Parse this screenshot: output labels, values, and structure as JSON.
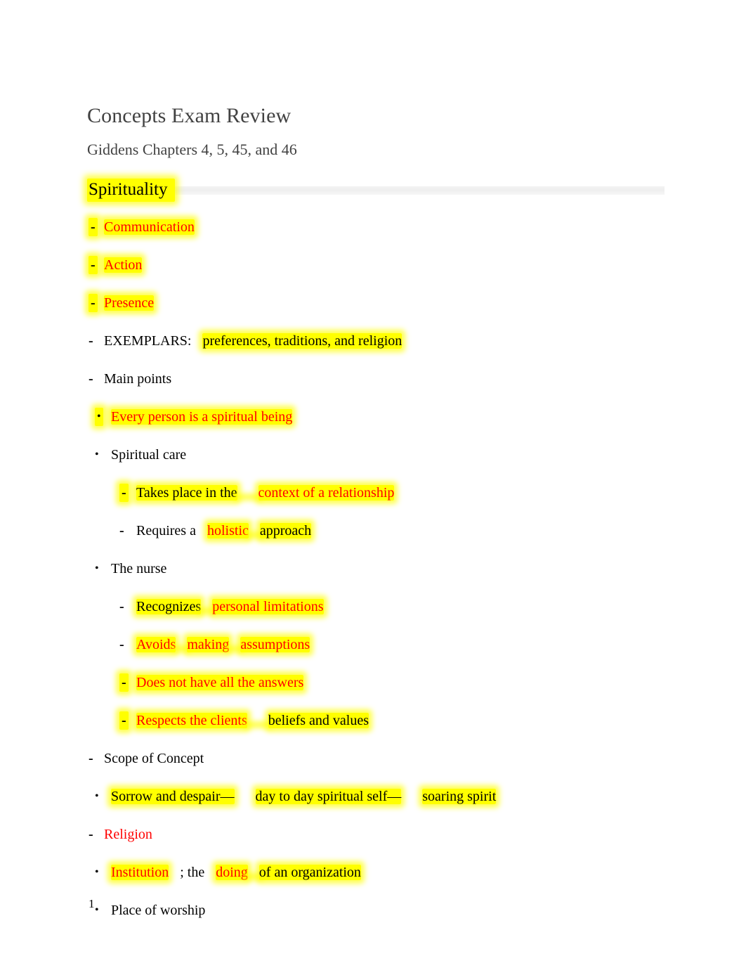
{
  "document": {
    "title": "Concepts Exam Review",
    "subtitle": "Giddens Chapters 4, 5, 45, and 46",
    "page_number": "1",
    "colors": {
      "highlight": "#ffff00",
      "emphasis_text": "#ff0000",
      "body_text": "#000000",
      "title_text": "#424242",
      "rule": "#eeeeee"
    }
  },
  "section": {
    "heading": "Spirituality",
    "items": {
      "communication": "Communication",
      "action": "Action",
      "presence": "Presence",
      "exemplars_label": "EXEMPLARS:",
      "exemplars_value": "preferences, traditions, and religion",
      "main_points": "Main points",
      "every_person": "Every person is a spiritual being",
      "spiritual_care": "Spiritual care",
      "takes_place_label": "Takes place in the",
      "takes_place_value": "context of a relationship",
      "requires_label": "Requires a",
      "requires_value": "holistic",
      "requires_tail": "approach",
      "the_nurse": "The nurse",
      "recognizes_label": "Recognizes",
      "recognizes_value": "personal limitations",
      "avoids": "Avoids",
      "making": "making",
      "assumptions": "assumptions",
      "does_not_have": "Does not have all the answers",
      "respects_label": "Respects the clients",
      "respects_value": "beliefs and values",
      "scope_of_concept": "Scope of Concept",
      "sorrow": "Sorrow and despair—",
      "day_to_day": "day to day spiritual self—",
      "soaring": "soaring spirit",
      "religion": "Religion",
      "institution": "Institution",
      "institution_mid": "; the",
      "doing": "doing",
      "doing_tail": "of an organization",
      "place_of_worship": "Place of worship"
    }
  }
}
